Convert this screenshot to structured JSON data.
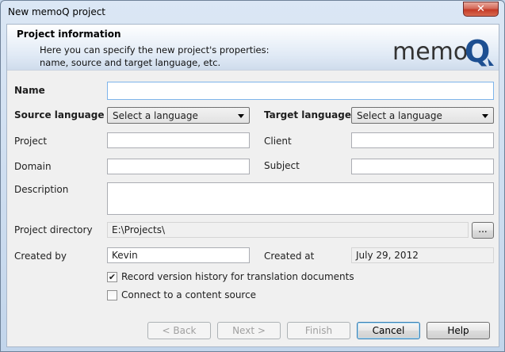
{
  "window": {
    "title": "New memoQ project",
    "close_label": "✕"
  },
  "banner": {
    "title": "Project information",
    "description_line1": "Here you can specify the new project's properties:",
    "description_line2": "name, source and target language, etc.",
    "logo_text": "memo",
    "logo_letter": "Q"
  },
  "form": {
    "name_label": "Name",
    "name_value": "",
    "source_label": "Source language",
    "source_value": "Select a language",
    "target_label": "Target language",
    "target_value": "Select a language",
    "project_label": "Project",
    "project_value": "",
    "client_label": "Client",
    "client_value": "",
    "domain_label": "Domain",
    "domain_value": "",
    "subject_label": "Subject",
    "subject_value": "",
    "description_label": "Description",
    "description_value": "",
    "directory_label": "Project directory",
    "directory_value": "E:\\Projects\\",
    "browse_label": "...",
    "created_by_label": "Created by",
    "created_by_value": "Kevin",
    "created_at_label": "Created at",
    "created_at_value": "July 29, 2012",
    "record_history_label": "Record version history for translation documents",
    "record_history_checked": true,
    "connect_label": "Connect to a content source",
    "connect_checked": false
  },
  "footer": {
    "back_label": "< Back",
    "next_label": "Next >",
    "finish_label": "Finish",
    "cancel_label": "Cancel",
    "help_label": "Help"
  },
  "colors": {
    "titlebar": "#c4d6ea",
    "close_button": "#c43a26",
    "logo_q": "#1d4f91",
    "logo_text": "#333333"
  }
}
